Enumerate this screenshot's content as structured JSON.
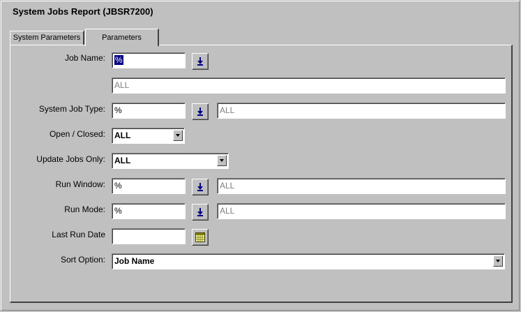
{
  "window": {
    "title": "System Jobs Report (JBSR7200)"
  },
  "tabs": [
    {
      "label": "System Parameters",
      "active": false
    },
    {
      "label": "Parameters",
      "active": true
    }
  ],
  "form": {
    "job_name": {
      "label": "Job Name:",
      "value": "%",
      "description": "ALL"
    },
    "system_job_type": {
      "label": "System Job Type:",
      "value": "%",
      "description": "ALL"
    },
    "open_closed": {
      "label": "Open / Closed:",
      "value": "ALL"
    },
    "update_jobs_only": {
      "label": "Update Jobs Only:",
      "value": "ALL"
    },
    "run_window": {
      "label": "Run Window:",
      "value": "%",
      "description": "ALL"
    },
    "run_mode": {
      "label": "Run Mode:",
      "value": "%",
      "description": "ALL"
    },
    "last_run_date": {
      "label": "Last Run Date",
      "value": ""
    },
    "sort_option": {
      "label": "Sort Option:",
      "value": "Job Name"
    }
  },
  "colors": {
    "background": "#c0c0c0",
    "selection": "#000080",
    "lookup_arrow": "#000080"
  },
  "icons": {
    "lookup": "down-arrow-icon",
    "calendar": "calendar-icon",
    "dropdown": "chevron-down-icon"
  }
}
